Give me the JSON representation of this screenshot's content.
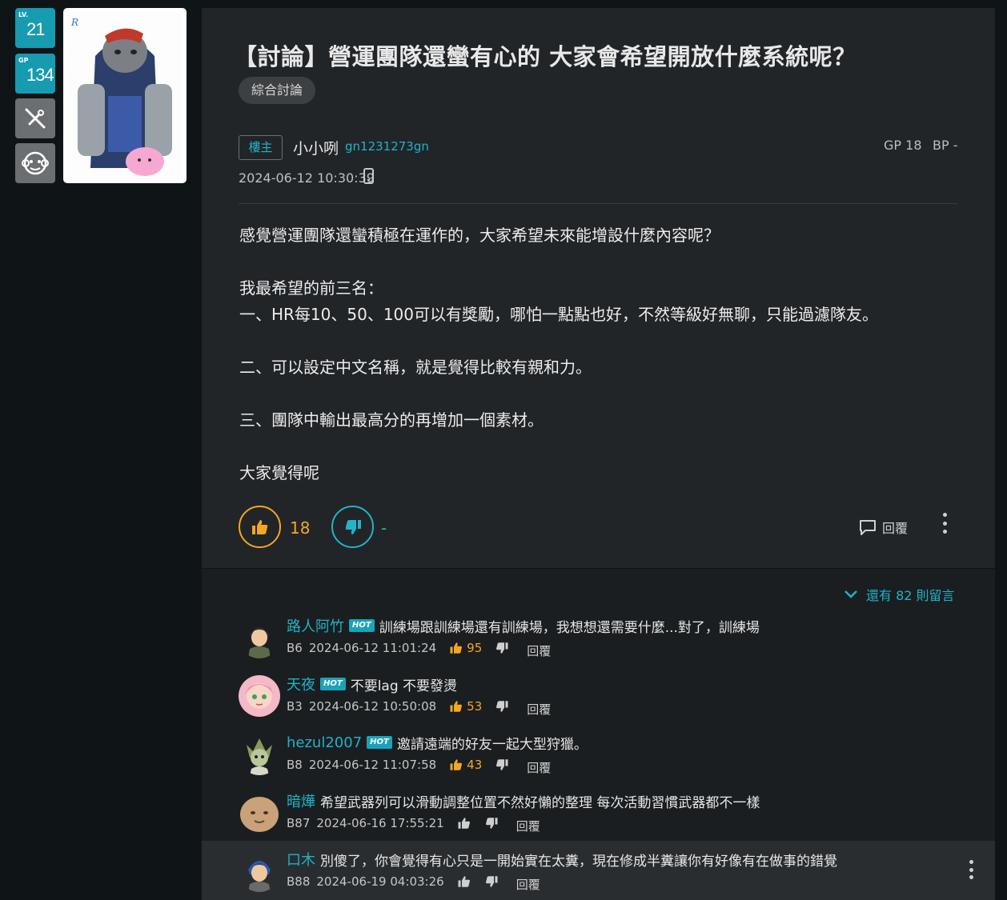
{
  "user": {
    "level_tag": "LV.",
    "level": "21",
    "gp_tag": "GP",
    "gp": "134",
    "tool_icon": "tool-icon",
    "mascot_icon": "mascot-icon"
  },
  "post": {
    "title": "【討論】營運團隊還蠻有心的 大家會希望開放什麼系統呢？",
    "category": "綜合討論",
    "op_tag": "樓主",
    "author_name": "小小咧",
    "author_id": "gn1231273gn",
    "time": "2024-06-12 10:30:39",
    "gp": "GP 18",
    "bp": "BP -",
    "body": [
      "感覺營運團隊還蠻積極在運作的，大家希望未來能增設什麼內容呢？",
      "",
      "我最希望的前三名：",
      "一、HR每10、50、100可以有獎勵，哪怕一點點也好，不然等級好無聊，只能過濾隊友。",
      "",
      "二、可以設定中文名稱，就是覺得比較有親和力。",
      "",
      "三、團隊中輸出最高分的再增加一個素材。",
      "",
      "大家覺得呢"
    ],
    "like_count": "18",
    "dislike_count": "-",
    "reply_label": "回覆"
  },
  "comments_meta": {
    "more_label": "還有 82 則留言"
  },
  "comments": [
    {
      "name": "路人阿竹",
      "hot": "HOT",
      "text": "訓練場跟訓練場還有訓練場，我想想還需要什麼...對了，訓練場",
      "floor": "B6",
      "time": "2024-06-12 11:01:24",
      "likes": "95",
      "reply": "回覆"
    },
    {
      "name": "天夜",
      "hot": "HOT",
      "text": "不要lag 不要發燙",
      "floor": "B3",
      "time": "2024-06-12 10:50:08",
      "likes": "53",
      "reply": "回覆"
    },
    {
      "name": "hezul2007",
      "hot": "HOT",
      "text": "邀請遠端的好友一起大型狩獵。",
      "floor": "B8",
      "time": "2024-06-12 11:07:58",
      "likes": "43",
      "reply": "回覆"
    },
    {
      "name": "暗燁",
      "hot": "",
      "text": "希望武器列可以滑動調整位置不然好懶的整理 每次活動習慣武器都不一樣",
      "floor": "B87",
      "time": "2024-06-16 17:55:21",
      "likes": "",
      "reply": "回覆"
    },
    {
      "name": "口木",
      "hot": "",
      "text": "別傻了，你會覺得有心只是一開始實在太糞，現在修成半糞讓你有好像有在做事的錯覺",
      "floor": "B88",
      "time": "2024-06-19 04:03:26",
      "likes": "",
      "reply": "回覆"
    }
  ],
  "colors": {
    "accent": "#1fb2c7",
    "like": "#f5a623",
    "card": "#222528",
    "background": "#0f1417"
  }
}
